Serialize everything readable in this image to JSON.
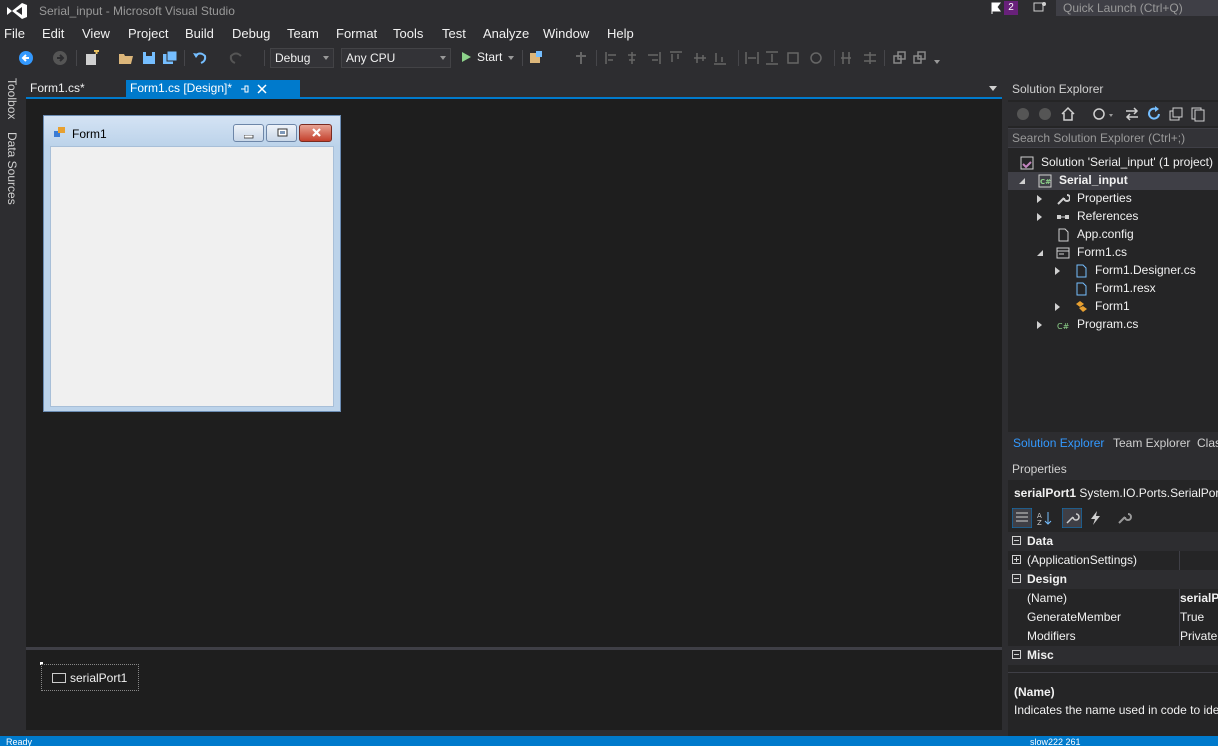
{
  "window": {
    "title": "Serial_input - Microsoft Visual Studio",
    "notification_count": "2",
    "quick_launch_placeholder": "Quick Launch (Ctrl+Q)"
  },
  "menu": [
    "File",
    "Edit",
    "View",
    "Project",
    "Build",
    "Debug",
    "Team",
    "Format",
    "Tools",
    "Test",
    "Analyze",
    "Window",
    "Help"
  ],
  "toolbar": {
    "configuration": "Debug",
    "platform": "Any CPU",
    "start_label": "Start"
  },
  "left_strip": {
    "toolbox": "Toolbox",
    "data_sources": "Data Sources"
  },
  "doc_tabs": {
    "tab1": "Form1.cs*",
    "tab2": "Form1.cs [Design]*"
  },
  "designer": {
    "form_title": "Form1",
    "component": "serialPort1"
  },
  "solution_explorer": {
    "header": "Solution Explorer",
    "search_placeholder": "Search Solution Explorer (Ctrl+;)",
    "tree": [
      "Solution 'Serial_input' (1 project)",
      "Serial_input",
      "Properties",
      "References",
      "App.config",
      "Form1.cs",
      "Form1.Designer.cs",
      "Form1.resx",
      "Form1",
      "Program.cs"
    ]
  },
  "panel_tabs": [
    "Solution Explorer",
    "Team Explorer",
    "Clas"
  ],
  "properties": {
    "header": "Properties",
    "object_name": "serialPort1",
    "object_type": "System.IO.Ports.SerialPort",
    "rows": [
      {
        "name": "Data",
        "value": ""
      },
      {
        "name": "(ApplicationSettings)",
        "value": ""
      },
      {
        "name": "Design",
        "value": ""
      },
      {
        "name": "(Name)",
        "value": "serialPo"
      },
      {
        "name": "GenerateMember",
        "value": "True"
      },
      {
        "name": "Modifiers",
        "value": "Private"
      },
      {
        "name": "Misc",
        "value": ""
      }
    ],
    "desc_title": "(Name)",
    "desc_text": "Indicates the name used in code to ide"
  },
  "status": {
    "left": "Ready",
    "right": "slow222    261"
  },
  "colors": {
    "accent": "#007acc",
    "background": "#2d2d30",
    "designer_bg": "#1e1e1e",
    "badge": "#68217a"
  }
}
